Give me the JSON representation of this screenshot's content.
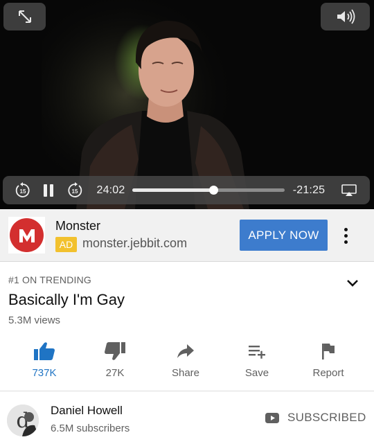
{
  "player": {
    "elapsed": "24:02",
    "remaining": "-21:25",
    "progress": 0.533,
    "skip_back_seconds": "15",
    "skip_forward_seconds": "15",
    "icons": {
      "fullscreen": "expand-arrows-icon",
      "volume": "speaker-icon",
      "skip_back": "rewind-15-icon",
      "play_pause": "pause-icon",
      "skip_forward": "forward-15-icon",
      "airplay": "airplay-icon"
    }
  },
  "ad": {
    "advertiser": "Monster",
    "badge": "AD",
    "url": "monster.jebbit.com",
    "cta": "APPLY NOW",
    "logo_letter": "M",
    "colors": {
      "cta": "#3d7ccd",
      "badge": "#f2c12e",
      "logo": "#d32f2f"
    }
  },
  "video": {
    "trending": "#1 ON TRENDING",
    "title": "Basically I'm Gay",
    "views": "5.3M views"
  },
  "actions": [
    {
      "label": "737K",
      "icon": "thumbs-up-icon",
      "active": true
    },
    {
      "label": "27K",
      "icon": "thumbs-down-icon",
      "active": false
    },
    {
      "label": "Share",
      "icon": "share-arrow-icon",
      "active": false
    },
    {
      "label": "Save",
      "icon": "playlist-add-icon",
      "active": false
    },
    {
      "label": "Report",
      "icon": "flag-icon",
      "active": false
    }
  ],
  "channel": {
    "name": "Daniel Howell",
    "subscribers": "6.5M subscribers",
    "subscribe_state": "SUBSCRIBED"
  },
  "colors": {
    "accent": "#1f74c4",
    "player_bg": "#070707"
  }
}
